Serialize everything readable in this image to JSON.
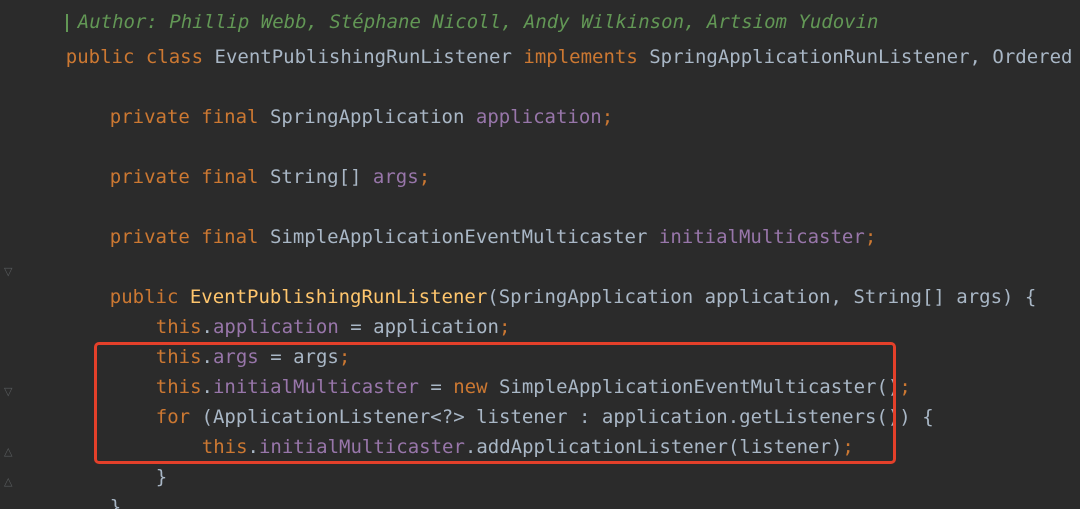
{
  "editor": {
    "comment": "Author: Phillip Webb, Stéphane Nicoll, Andy Wilkinson, Artsiom Yudovin",
    "lines": [
      {
        "id": "class-decl",
        "kw1": "public",
        "kw2": "class",
        "name": "EventPublishingRunListener",
        "kw3": "implements",
        "iface": "SpringApplicationRunListener,",
        "iface2": "Ordered",
        "brace": "{"
      },
      {
        "id": "field-application",
        "kw1": "private",
        "kw2": "final",
        "type": "SpringApplication",
        "name": "application",
        "end": ";"
      },
      {
        "id": "field-args",
        "kw1": "private",
        "kw2": "final",
        "type": "String[]",
        "name": "args",
        "end": ";"
      },
      {
        "id": "field-multicaster",
        "kw1": "private",
        "kw2": "final",
        "type": "SimpleApplicationEventMulticaster",
        "name": "initialMulticaster",
        "end": ";"
      },
      {
        "id": "ctor-decl",
        "kw1": "public",
        "name": "EventPublishingRunListener",
        "params": "(SpringApplication application, String[] args) {"
      },
      {
        "id": "assign-application",
        "this": "this",
        "dot": ".",
        "field": "application",
        "rest": " = application",
        "end": ";"
      },
      {
        "id": "assign-args",
        "this": "this",
        "dot": ".",
        "field": "args",
        "rest": " = args",
        "end": ";"
      },
      {
        "id": "assign-multicaster",
        "this": "this",
        "dot": ".",
        "field": "initialMulticaster",
        "eq": " = ",
        "new": "new",
        "rest": " SimpleApplicationEventMulticaster()",
        "end": ";"
      },
      {
        "id": "for-loop",
        "for": "for",
        "rest": " (ApplicationListener<?> listener : application.getListeners()) {"
      },
      {
        "id": "add-listener",
        "this": "this",
        "dot": ".",
        "field": "initialMulticaster",
        "rest": ".addApplicationListener(listener)",
        "end": ";"
      },
      {
        "id": "close-for",
        "brace": "}"
      },
      {
        "id": "close-ctor",
        "brace": "}"
      }
    ],
    "colors": {
      "background": "#2b2b2b",
      "keyword": "#cc7832",
      "field": "#9876aa",
      "method": "#ffc66d",
      "text": "#a9b7c6",
      "comment": "#629755",
      "highlight": "#e4402a"
    }
  }
}
